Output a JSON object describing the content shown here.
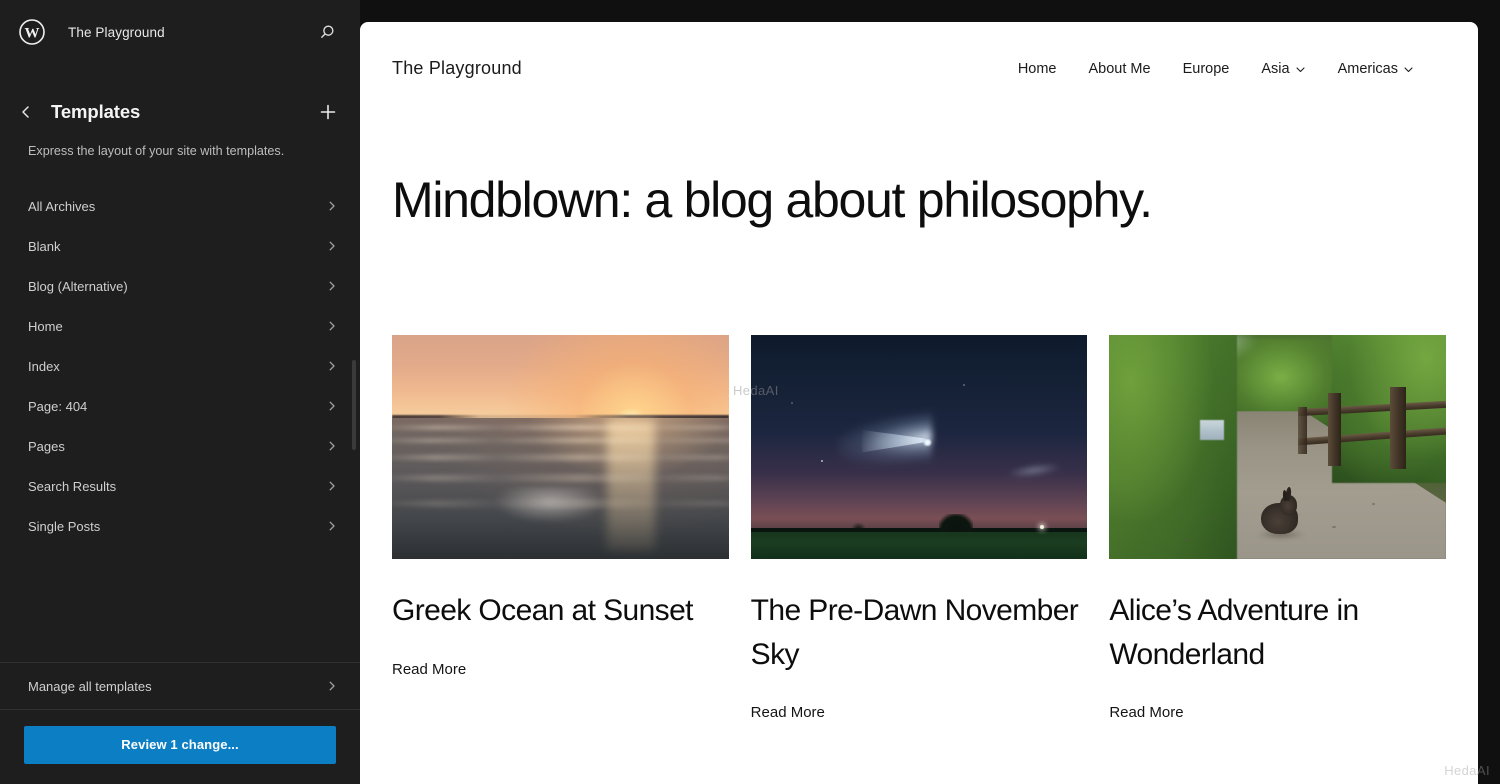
{
  "sidebar": {
    "logo_icon": "wordpress-logo-icon",
    "site_name": "The Playground",
    "search_icon": "search-icon",
    "back_icon": "chevron-left-icon",
    "panel_title": "Templates",
    "add_icon": "plus-icon",
    "panel_description": "Express the layout of your site with templates.",
    "templates": [
      {
        "label": "All Archives"
      },
      {
        "label": "Blank"
      },
      {
        "label": "Blog (Alternative)"
      },
      {
        "label": "Home"
      },
      {
        "label": "Index"
      },
      {
        "label": "Page: 404"
      },
      {
        "label": "Pages"
      },
      {
        "label": "Search Results"
      },
      {
        "label": "Single Posts"
      }
    ],
    "manage_all_label": "Manage all templates",
    "save_button_label": "Review 1 change...",
    "accent_color": "#0b7ec4",
    "background_color": "#1e1e1e"
  },
  "canvas": {
    "site_title": "The Playground",
    "nav": [
      {
        "label": "Home",
        "has_submenu": false
      },
      {
        "label": "About Me",
        "has_submenu": false
      },
      {
        "label": "Europe",
        "has_submenu": false
      },
      {
        "label": "Asia",
        "has_submenu": true
      },
      {
        "label": "Americas",
        "has_submenu": true
      }
    ],
    "hero_heading": "Mindblown: a blog about philosophy.",
    "posts": [
      {
        "image_alt": "ocean-sunset-image",
        "title": "Greek Ocean at Sunset",
        "read_more": "Read More"
      },
      {
        "image_alt": "pre-dawn-sky-image",
        "title": "The Pre-Dawn November Sky",
        "read_more": "Read More"
      },
      {
        "image_alt": "woodland-path-rabbit-image",
        "title": "Alice’s Adventure in Wonderland",
        "read_more": "Read More"
      }
    ]
  },
  "watermark": {
    "center": "HedaAI",
    "corner": "HedaAI"
  }
}
